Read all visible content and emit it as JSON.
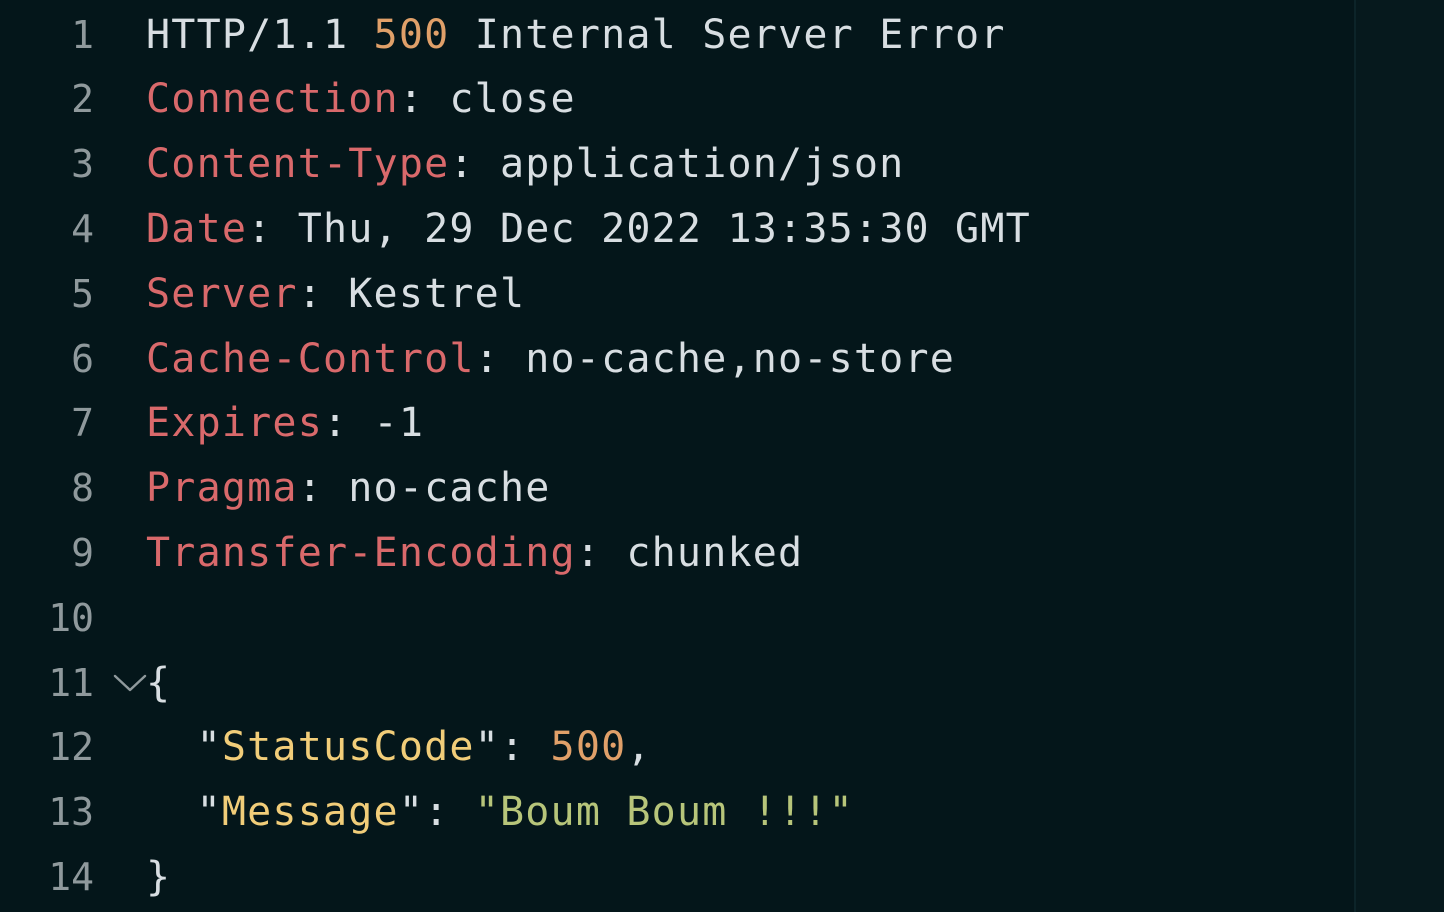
{
  "colors": {
    "background": "#04161a",
    "line_number": "#8f999c",
    "text": "#d8dee2",
    "number": "#e0a069",
    "header_key": "#d9696b",
    "json_key": "#f1cd79",
    "string": "#b7c57a"
  },
  "editor": {
    "fold_icon": "chevron-down-icon",
    "lines": [
      {
        "number": "1",
        "tokens": [
          {
            "t": "HTTP/1.1 ",
            "c": "c-text"
          },
          {
            "t": "500",
            "c": "c-num"
          },
          {
            "t": " Internal Server Error",
            "c": "c-text"
          }
        ]
      },
      {
        "number": "2",
        "tokens": [
          {
            "t": "Connection",
            "c": "c-key"
          },
          {
            "t": ": close",
            "c": "c-text"
          }
        ]
      },
      {
        "number": "3",
        "tokens": [
          {
            "t": "Content-Type",
            "c": "c-key"
          },
          {
            "t": ": application/json",
            "c": "c-text"
          }
        ]
      },
      {
        "number": "4",
        "tokens": [
          {
            "t": "Date",
            "c": "c-key"
          },
          {
            "t": ": Thu, 29 Dec 2022 13:35:30 GMT",
            "c": "c-text"
          }
        ]
      },
      {
        "number": "5",
        "tokens": [
          {
            "t": "Server",
            "c": "c-key"
          },
          {
            "t": ": Kestrel",
            "c": "c-text"
          }
        ]
      },
      {
        "number": "6",
        "tokens": [
          {
            "t": "Cache-Control",
            "c": "c-key"
          },
          {
            "t": ": no-cache,no-store",
            "c": "c-text"
          }
        ]
      },
      {
        "number": "7",
        "tokens": [
          {
            "t": "Expires",
            "c": "c-key"
          },
          {
            "t": ": -1",
            "c": "c-text"
          }
        ]
      },
      {
        "number": "8",
        "tokens": [
          {
            "t": "Pragma",
            "c": "c-key"
          },
          {
            "t": ": no-cache",
            "c": "c-text"
          }
        ]
      },
      {
        "number": "9",
        "tokens": [
          {
            "t": "Transfer-Encoding",
            "c": "c-key"
          },
          {
            "t": ": chunked",
            "c": "c-text"
          }
        ]
      },
      {
        "number": "10",
        "tokens": []
      },
      {
        "number": "11",
        "fold": true,
        "tokens": [
          {
            "t": "{",
            "c": "c-punc"
          }
        ]
      },
      {
        "number": "12",
        "tokens": [
          {
            "t": "  \"",
            "c": "c-punc"
          },
          {
            "t": "StatusCode",
            "c": "c-jkey"
          },
          {
            "t": "\": ",
            "c": "c-punc"
          },
          {
            "t": "500",
            "c": "c-num"
          },
          {
            "t": ",",
            "c": "c-punc"
          }
        ]
      },
      {
        "number": "13",
        "tokens": [
          {
            "t": "  \"",
            "c": "c-punc"
          },
          {
            "t": "Message",
            "c": "c-jkey"
          },
          {
            "t": "\": ",
            "c": "c-punc"
          },
          {
            "t": "\"Boum Boum !!!\"",
            "c": "c-str"
          }
        ]
      },
      {
        "number": "14",
        "tokens": [
          {
            "t": "}",
            "c": "c-punc"
          }
        ]
      }
    ]
  }
}
